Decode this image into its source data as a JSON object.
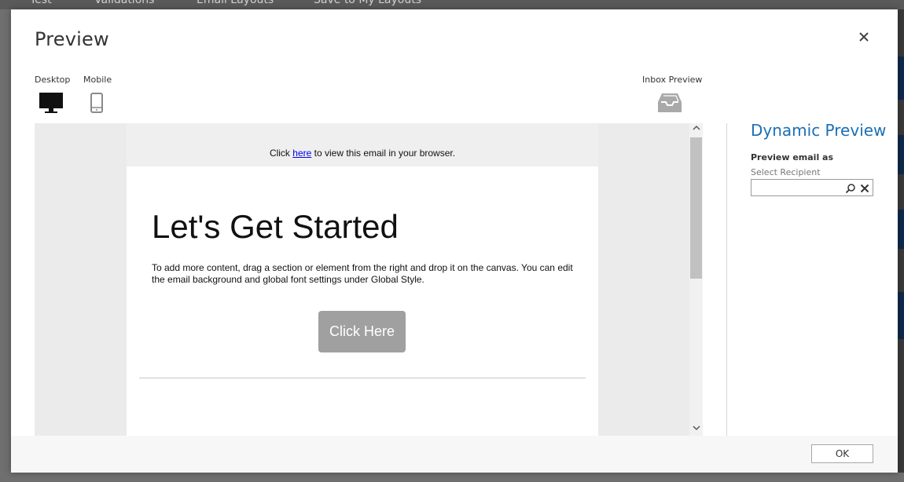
{
  "background_toolbar": {
    "items": [
      "Test",
      "Validations",
      "Email Layouts",
      "Save to My Layouts"
    ]
  },
  "dialog": {
    "title": "Preview",
    "close_icon": "close-icon"
  },
  "devices": {
    "desktop_label": "Desktop",
    "mobile_label": "Mobile",
    "inbox_label": "Inbox Preview",
    "selected": "Desktop"
  },
  "email": {
    "view_prefix": "Click ",
    "view_link": "here",
    "view_suffix": " to view this email in your browser.",
    "headline": "Let's Get Started",
    "body": "To add more content, drag a section or element from the right and drop it on the canvas. You can edit the email background and global font settings under Global Style.",
    "cta_label": "Click Here"
  },
  "dynamic_preview": {
    "title": "Dynamic Preview",
    "preview_as_label": "Preview email as",
    "select_recipient_label": "Select Recipient",
    "recipient_value": ""
  },
  "footer": {
    "ok_label": "OK"
  },
  "colors": {
    "accent": "#1a6fb5",
    "cta_bg": "#a0a0a0",
    "link": "#0000ee"
  }
}
